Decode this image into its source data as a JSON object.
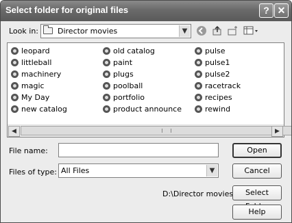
{
  "title": "Select folder for original files",
  "titlebar": {
    "help_label": "?",
    "close_label": "✕"
  },
  "look_in": {
    "label": "Look in:",
    "value": "Director movies"
  },
  "files": {
    "col1": [
      "leopard",
      "littleball",
      "machinery",
      "magic",
      "My Day",
      "new catalog"
    ],
    "col2": [
      "old catalog",
      "paint",
      "plugs",
      "poolball",
      "portfolio",
      "product announce"
    ],
    "col3": [
      "pulse",
      "pulse1",
      "pulse2",
      "racetrack",
      "recipes",
      "rewind"
    ]
  },
  "file_name": {
    "label": "File name:",
    "value": ""
  },
  "file_type": {
    "label": "Files of type:",
    "value": "All Files"
  },
  "buttons": {
    "open": "Open",
    "cancel": "Cancel",
    "select_folder": "Select Folder",
    "help": "Help"
  },
  "current_path": "D:\\Director movies"
}
